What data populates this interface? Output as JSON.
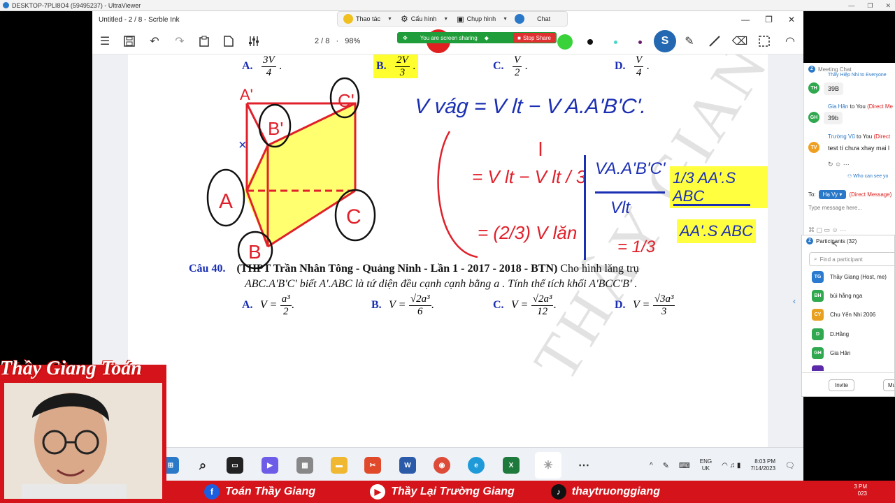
{
  "uv": {
    "title": "DESKTOP-7PLI8O4 (59495237) - UltraViewer"
  },
  "app": {
    "title": "Untitled - 2 / 8 - Scrble Ink",
    "page_info": "2 / 8",
    "zoom": "98%"
  },
  "float_bar": {
    "action": "Thao tác",
    "config": "Cấu hình",
    "capture": "Chụp hình",
    "chat": "Chat"
  },
  "share": {
    "text": "You are screen sharing",
    "stop": "Stop Share"
  },
  "prev_answers": {
    "a": {
      "letter": "A.",
      "num": "3V",
      "den": "4"
    },
    "b": {
      "letter": "B.",
      "num": "2V",
      "den": "3"
    },
    "c": {
      "letter": "C.",
      "num": "V",
      "den": "2"
    },
    "d": {
      "letter": "D.",
      "num": "V",
      "den": "4"
    }
  },
  "question": {
    "label": "Câu 40.",
    "source": "(THPT Trần Nhân Tông - Quảng Ninh - Lần 1 - 2017 - 2018 - BTN)",
    "line1_rest": "Cho hình lăng trụ",
    "line2": "ABC.A'B'C'  biết  A'.ABC  là tứ diện đều cạnh cạnh bằng  a . Tính thể tích khối  A'BCC'B' .",
    "options": [
      {
        "letter": "A.",
        "lhs": "V =",
        "num": "a³",
        "den": "2"
      },
      {
        "letter": "B.",
        "lhs": "V =",
        "num": "√2a³",
        "den": "6"
      },
      {
        "letter": "C.",
        "lhs": "V =",
        "num": "√2a³",
        "den": "12"
      },
      {
        "letter": "D.",
        "lhs": "V =",
        "num": "√3a³",
        "den": "3"
      }
    ]
  },
  "handwriting": {
    "vdiff": "V vág = V lt − V A.A'B'C'.",
    "step1": "= V lt − V lt / 3",
    "step2": "= (2/3) V lăn",
    "ratio_num": "VA.A'B'C'",
    "ratio_den": "Vlt",
    "ratio_rhs1": "1/3 AA'.S ABC",
    "ratio_rhs2": "AA'.S ABC",
    "ratio_eq": "= 1/3",
    "labels": {
      "A_top": "A'",
      "B_top": "B'",
      "C_top": "C'",
      "A": "A",
      "B": "B",
      "C": "C"
    }
  },
  "watermark": "THẦY GIANG",
  "chat": {
    "header": "Meeting Chat",
    "top_partial": "Thầy Hiệp Nhi to Everyone",
    "messages": [
      {
        "initials": "TH",
        "sender": "",
        "text": "39B",
        "color": "#2fa84f"
      },
      {
        "initials": "GH",
        "sender": "Gia Hân",
        "to": "to You",
        "dm": "(Direct Me",
        "text": "39b",
        "color": "#2fa84f"
      },
      {
        "initials": "TV",
        "sender": "Trường Vũ",
        "to": "to You",
        "dm": "(Direct",
        "text": "test tí chưa xhay mai l",
        "color": "#f0a020"
      }
    ],
    "who_can_see": "Who can see yo",
    "to_label": "To:",
    "to_recipient": "Hạ Vy",
    "to_dm": "(Direct Message)",
    "placeholder": "Type message here..."
  },
  "participants": {
    "header": "Participants (32)",
    "search_placeholder": "Find a participant",
    "list": [
      {
        "initials": "TG",
        "name": "Thầy Giang (Host, me)",
        "color": "#2a7ad0"
      },
      {
        "initials": "BH",
        "name": "bùi hằng nga",
        "color": "#2fa84f"
      },
      {
        "initials": "CY",
        "name": "Chu Yến Nhi 2006",
        "color": "#e8a020"
      },
      {
        "initials": "D",
        "name": "D.Hằng",
        "color": "#2fa84f"
      },
      {
        "initials": "GH",
        "name": "Gia Hân",
        "color": "#2fa84f"
      }
    ],
    "invite": "Invite",
    "mute": "Mu"
  },
  "taskbar": {
    "lang1": "ENG",
    "lang2": "UK",
    "time": "8:03 PM",
    "date": "7/14/2023"
  },
  "banner": {
    "facebook": "Toán Thầy Giang",
    "youtube": "Thầy Lại Trường Giang",
    "tiktok": "thaytruonggiang",
    "clock_partial_time": "3 PM",
    "clock_partial_date": "023"
  },
  "cam_title": "Thầy Giang Toán"
}
